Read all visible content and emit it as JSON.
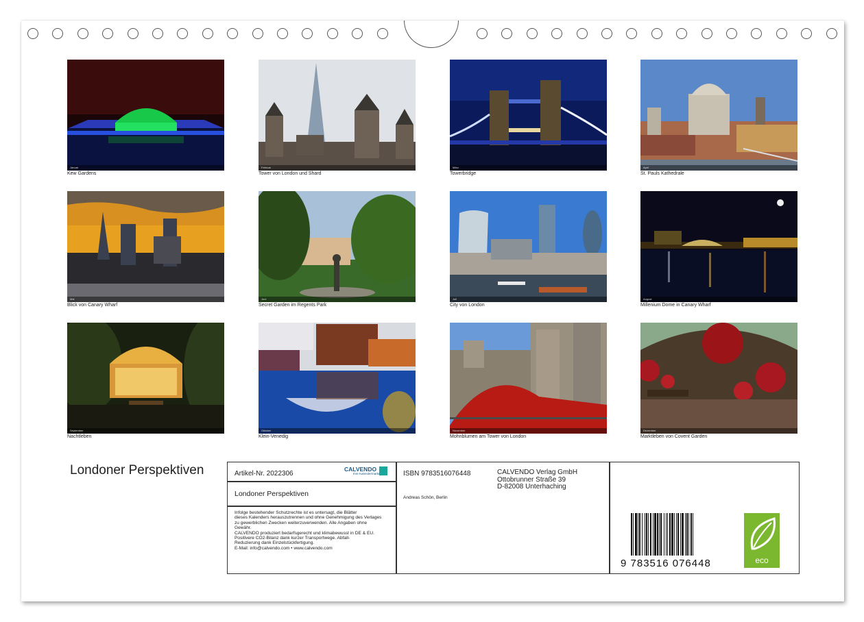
{
  "calendar_title": "Londoner Perspektiven",
  "photos": [
    {
      "caption": "Kew Gardens",
      "month": "Januar"
    },
    {
      "caption": "Tower von London und Shard",
      "month": "Februar"
    },
    {
      "caption": "Towerbridge",
      "month": "März"
    },
    {
      "caption": "St. Pauls Kathedrale",
      "month": "April"
    },
    {
      "caption": "Blick von Canary Wharf",
      "month": "Mai"
    },
    {
      "caption": "Secret Garden im Regents Park",
      "month": "Juni"
    },
    {
      "caption": "City von London",
      "month": "Juli"
    },
    {
      "caption": "Millenium Dome in Canary Wharf",
      "month": "August"
    },
    {
      "caption": "Nachtleben",
      "month": "September"
    },
    {
      "caption": "Klein-Venedig",
      "month": "Oktober"
    },
    {
      "caption": "Mohnblumen am Tower von London",
      "month": "November"
    },
    {
      "caption": "Marktleben von Covent Garden",
      "month": "Dezember"
    }
  ],
  "info": {
    "article_no": "Artikel-Nr. 2022306",
    "brand": "CALVENDO",
    "brand_sub": "Ihre Kalendermarke",
    "title": "Londoner Perspektiven",
    "legal_lines": [
      "Infolge bestehender Schutzrechte ist es untersagt, die Blätter",
      "dieses Kalenders herauszutrennen und ohne Genehmigung des Verlages",
      "zu gewerblichen Zwecken weiterzuverwenden. Alle Angaben ohne",
      "Gewähr.",
      "CALVENDO produziert bedarfsgerecht und klimabewusst in DE & EU.",
      "Positivere CO2-Bilanz dank kurzer Transportwege. Abfall-",
      "Reduzierung dank Einzelstückfertigung.",
      "E-Mail: info@calvendo.com • www.calvendo.com"
    ],
    "isbn": "ISBN 9783516076448",
    "author": "Andreas Schön, Berlin",
    "publisher_lines": [
      "CALVENDO Verlag GmbH",
      "Ottobrunner Straße 39",
      "D-82008 Unterhaching"
    ],
    "barcode_number": "9 783516 076448",
    "eco_label": "eco"
  },
  "colors": {
    "border": "#333333",
    "eco_green": "#7cb82f"
  }
}
